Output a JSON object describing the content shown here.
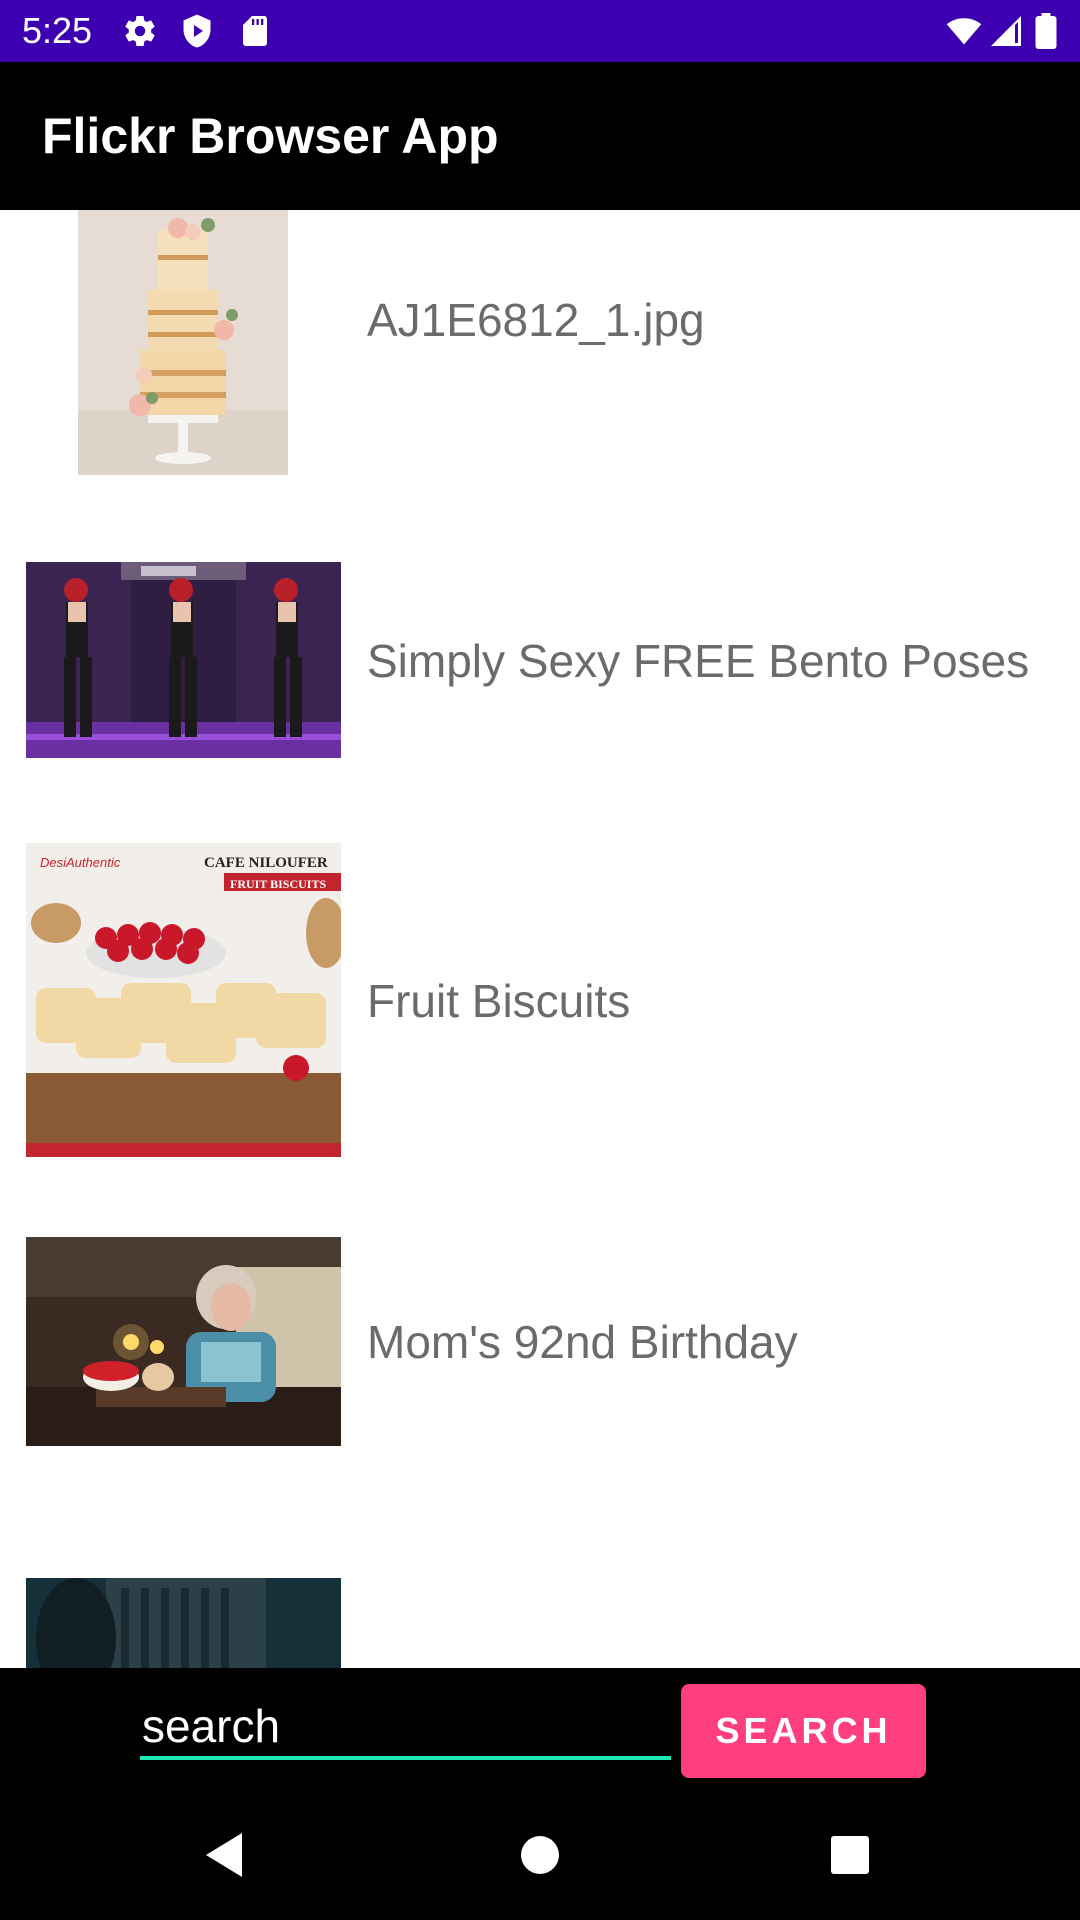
{
  "status_bar": {
    "time": "5:25",
    "icons": [
      "gear-icon",
      "shield-play-icon",
      "sd-card-icon",
      "wifi-icon",
      "signal-icon",
      "battery-icon"
    ]
  },
  "app_bar": {
    "title": "Flickr Browser App"
  },
  "photos": [
    {
      "title": "AJ1E6812_1.jpg"
    },
    {
      "title": "Simply Sexy FREE Bento Poses"
    },
    {
      "title": "Fruit Biscuits"
    },
    {
      "title": "Mom's 92nd Birthday"
    }
  ],
  "search": {
    "placeholder": "search",
    "button_label": "SEARCH"
  },
  "nav": {
    "icons": [
      "back-icon",
      "home-icon",
      "recents-icon"
    ]
  },
  "colors": {
    "status_bar": "#3d00b0",
    "app_bar": "#000000",
    "accent": "#1de9b6",
    "button": "#ff3d81",
    "title_text": "#6b6b6b"
  }
}
